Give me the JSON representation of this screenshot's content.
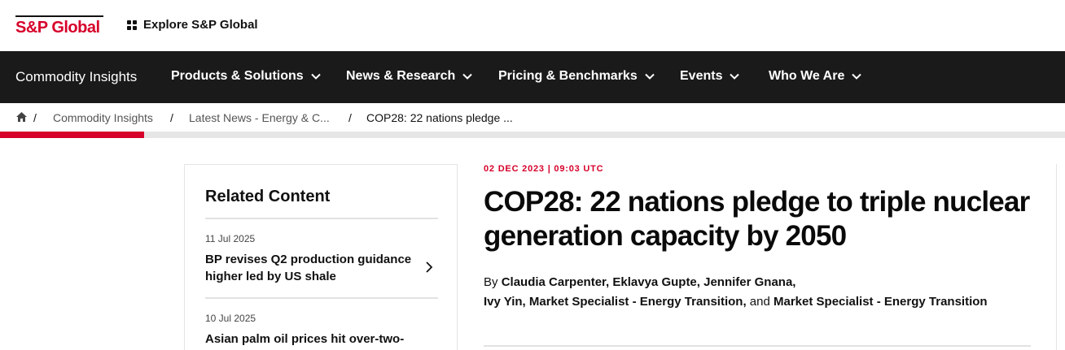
{
  "topbar": {
    "logo_text": "S&P Global",
    "explore_label": "Explore S&P Global"
  },
  "nav": {
    "brand": "Commodity Insights",
    "items": [
      {
        "label": "Products & Solutions"
      },
      {
        "label": "News & Research"
      },
      {
        "label": "Pricing & Benchmarks"
      },
      {
        "label": "Events"
      },
      {
        "label": "Who We Are"
      }
    ]
  },
  "breadcrumb": {
    "separator": "/",
    "items": [
      {
        "label": "Commodity Insights"
      },
      {
        "label": "Latest News - Energy & C..."
      },
      {
        "label": "COP28: 22 nations pledge ..."
      }
    ]
  },
  "reading_progress": 0.135,
  "related": {
    "title": "Related Content",
    "items": [
      {
        "date": "11 Jul 2025",
        "title": "BP revises Q2 production guidance higher led by US shale"
      },
      {
        "date": "10 Jul 2025",
        "title": "Asian palm oil prices hit over-two-"
      }
    ]
  },
  "article": {
    "dateline": "02 DEC 2023 | 09:03 UTC",
    "headline": "COP28: 22 nations pledge to triple nuclear generation capacity by 2050",
    "byline_prefix": "By",
    "authors_line1": "Claudia Carpenter, Eklavya Gupte, Jennifer Gnana,",
    "authors_line2a": "Ivy Yin, Market Specialist - Energy Transition,",
    "byline_and": "and",
    "authors_line2b": "Market Specialist - Energy Transition"
  },
  "colors": {
    "brand_red": "#d6002a",
    "nav_bg": "#1a1a1a"
  }
}
